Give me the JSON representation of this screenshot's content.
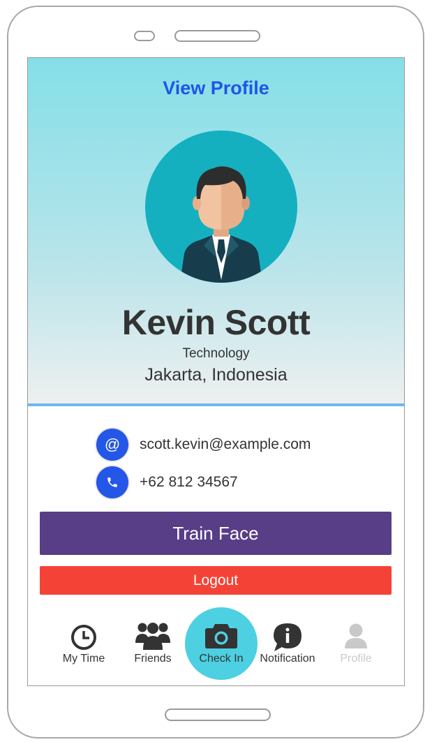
{
  "header": {
    "title": "View Profile"
  },
  "profile": {
    "name": "Kevin Scott",
    "department": "Technology",
    "location": "Jakarta, Indonesia"
  },
  "contact": {
    "email_icon_glyph": "@",
    "email": "scott.kevin@example.com",
    "phone": "+62 812 34567"
  },
  "actions": {
    "train_face": "Train Face",
    "logout": "Logout"
  },
  "nav": {
    "items": [
      {
        "label": "My Time",
        "icon": "clock-icon"
      },
      {
        "label": "Friends",
        "icon": "group-icon"
      },
      {
        "label": "Check In",
        "icon": "camera-icon"
      },
      {
        "label": "Notification",
        "icon": "info-bubble-icon"
      },
      {
        "label": "Profile",
        "icon": "user-icon",
        "disabled": true
      }
    ]
  },
  "colors": {
    "accent_blue": "#1f55e6",
    "train_button": "#583d87",
    "logout_button": "#f44336",
    "checkin_circle": "#4dd0e1",
    "avatar_bg": "#14b0c0"
  }
}
